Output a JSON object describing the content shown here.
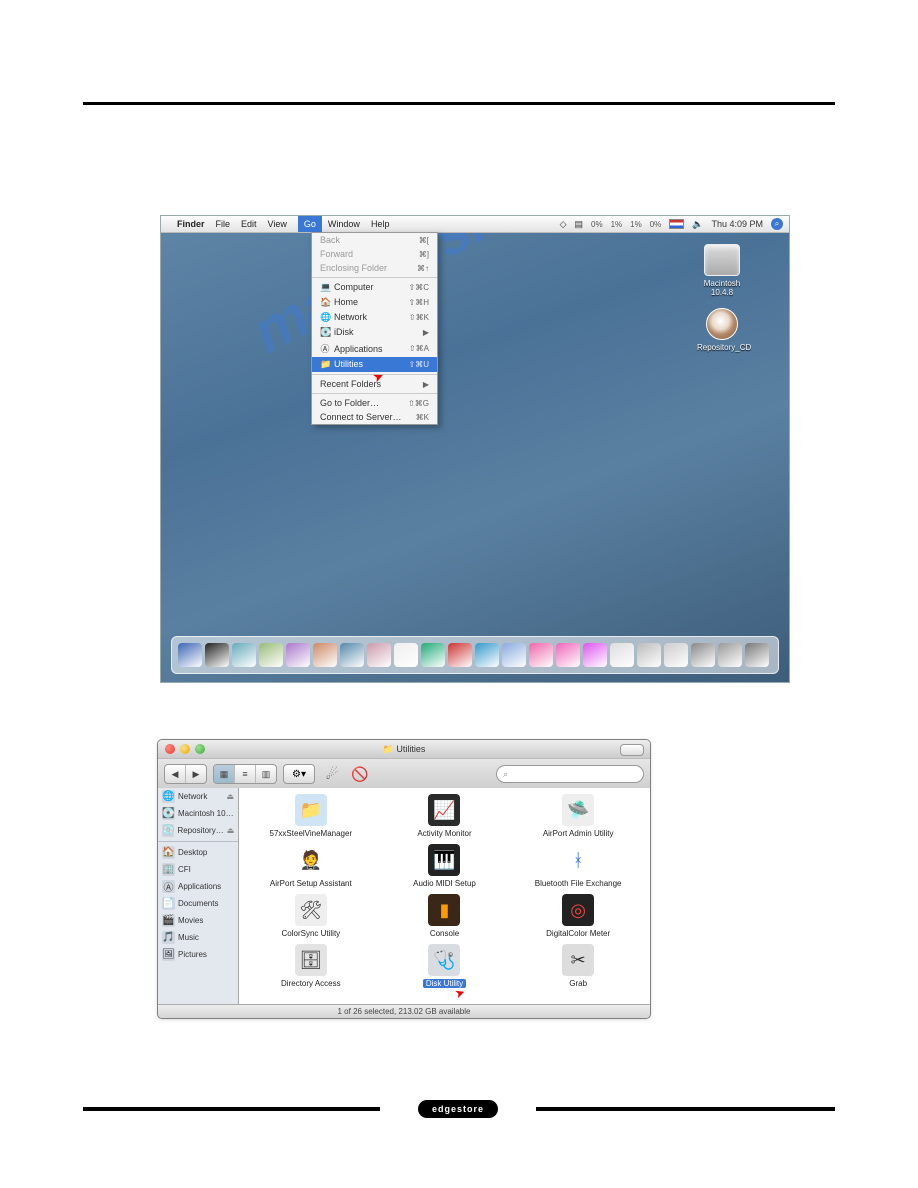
{
  "brand": "edgestore",
  "watermark": "manualshive.com",
  "desktop": {
    "menubar": {
      "app": "Finder",
      "items": [
        "File",
        "Edit",
        "View",
        "Go",
        "Window",
        "Help"
      ],
      "selected": "Go",
      "stats": [
        "0%",
        "1%",
        "1%",
        "0%"
      ],
      "clock": "Thu 4:09 PM"
    },
    "go_menu": [
      {
        "label": "Back",
        "shortcut": "⌘[",
        "disabled": true
      },
      {
        "label": "Forward",
        "shortcut": "⌘]",
        "disabled": true
      },
      {
        "label": "Enclosing Folder",
        "shortcut": "⌘↑",
        "disabled": true
      },
      {
        "sep": true
      },
      {
        "icon": "💻",
        "label": "Computer",
        "shortcut": "⇧⌘C"
      },
      {
        "icon": "🏠",
        "label": "Home",
        "shortcut": "⇧⌘H"
      },
      {
        "icon": "🌐",
        "label": "Network",
        "shortcut": "⇧⌘K"
      },
      {
        "icon": "💽",
        "label": "iDisk",
        "shortcut": "▶"
      },
      {
        "icon": "Ⓐ",
        "label": "Applications",
        "shortcut": "⇧⌘A"
      },
      {
        "icon": "📁",
        "label": "Utilities",
        "shortcut": "⇧⌘U",
        "selected": true
      },
      {
        "sep": true
      },
      {
        "label": "Recent Folders",
        "shortcut": "▶"
      },
      {
        "sep": true
      },
      {
        "label": "Go to Folder…",
        "shortcut": "⇧⌘G"
      },
      {
        "label": "Connect to Server…",
        "shortcut": "⌘K"
      }
    ],
    "icons": [
      {
        "label": "Macintosh 10.4.8",
        "type": "hd"
      },
      {
        "label": "Repository_CD",
        "type": "cd"
      }
    ]
  },
  "finder": {
    "title": "Utilities",
    "search_placeholder": "",
    "sidebar_top": [
      {
        "icon": "🌐",
        "label": "Network",
        "eject": true
      },
      {
        "icon": "💽",
        "label": "Macintosh 10…"
      },
      {
        "icon": "💿",
        "label": "Repository…",
        "eject": true
      }
    ],
    "sidebar_places": [
      {
        "icon": "🏠",
        "label": "Desktop"
      },
      {
        "icon": "🏢",
        "label": "CFI"
      },
      {
        "icon": "Ⓐ",
        "label": "Applications"
      },
      {
        "icon": "📄",
        "label": "Documents"
      },
      {
        "icon": "🎬",
        "label": "Movies"
      },
      {
        "icon": "🎵",
        "label": "Music"
      },
      {
        "icon": "🖼",
        "label": "Pictures"
      }
    ],
    "items": [
      {
        "label": "57xxSteelVineManager",
        "emoji": "📁",
        "bg": "#cfe5f5"
      },
      {
        "label": "Activity Monitor",
        "emoji": "📈",
        "bg": "#2a2a2a",
        "fg": "#5dd"
      },
      {
        "label": "AirPort Admin Utility",
        "emoji": "🛸",
        "bg": "#eee"
      },
      {
        "label": "AirPort Setup Assistant",
        "emoji": "🤵",
        "bg": "#fff"
      },
      {
        "label": "Audio MIDI Setup",
        "emoji": "🎹",
        "bg": "#222",
        "fg": "#fff"
      },
      {
        "label": "Bluetooth File Exchange",
        "emoji": "ᚼ",
        "bg": "#fff",
        "fg": "#2a6bd4"
      },
      {
        "label": "ColorSync Utility",
        "emoji": "🛠",
        "bg": "#eee"
      },
      {
        "label": "Console",
        "emoji": "▮",
        "bg": "#3a2718",
        "fg": "#f90"
      },
      {
        "label": "DigitalColor Meter",
        "emoji": "◎",
        "bg": "#222",
        "fg": "#e44"
      },
      {
        "label": "Directory Access",
        "emoji": "🗄",
        "bg": "#e3e3e3"
      },
      {
        "label": "Disk Utility",
        "emoji": "🩺",
        "bg": "#d9dde2",
        "selected": true
      },
      {
        "label": "Grab",
        "emoji": "✂",
        "bg": "#ddd"
      }
    ],
    "status": "1 of 26 selected, 213.02 GB available"
  }
}
